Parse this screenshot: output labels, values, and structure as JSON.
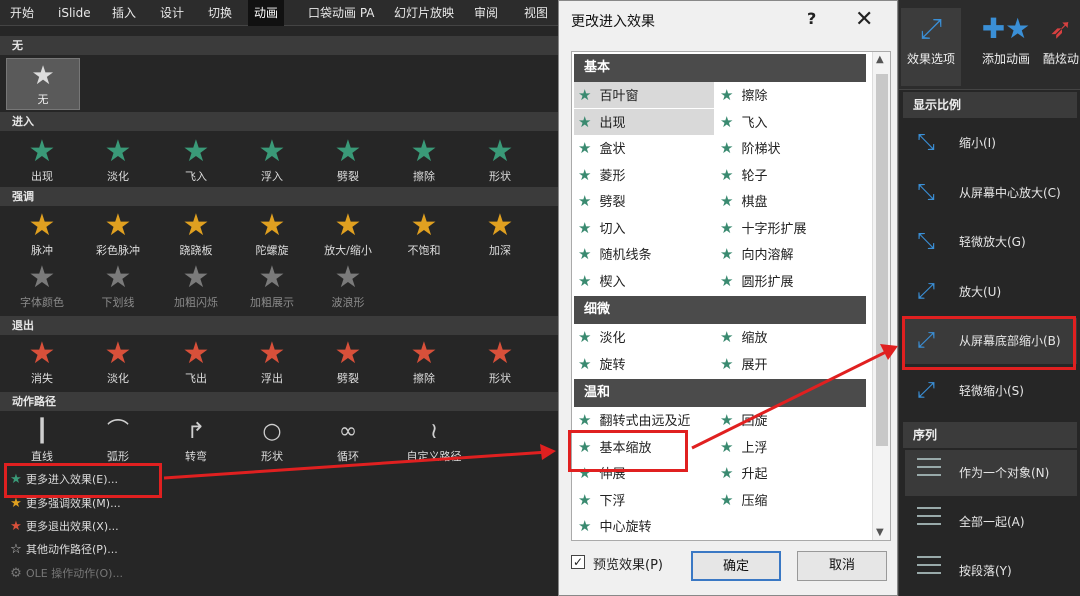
{
  "ribbon": {
    "tabs": [
      "开始",
      "iSlide",
      "插入",
      "设计",
      "切换",
      "动画",
      "口袋动画 PA",
      "幻灯片放映",
      "审阅",
      "视图"
    ],
    "active_tab": "动画"
  },
  "gallery": {
    "none_section": "无",
    "none_label": "无",
    "entrance_section": "进入",
    "entrance": [
      "出现",
      "淡化",
      "飞入",
      "浮入",
      "劈裂",
      "擦除",
      "形状"
    ],
    "emphasis_section": "强调",
    "emphasis_row1": [
      "脉冲",
      "彩色脉冲",
      "跷跷板",
      "陀螺旋",
      "放大/缩小",
      "不饱和",
      "加深"
    ],
    "emphasis_row2": [
      "字体颜色",
      "下划线",
      "加粗闪烁",
      "加粗展示",
      "波浪形"
    ],
    "exit_section": "退出",
    "exit": [
      "消失",
      "淡化",
      "飞出",
      "浮出",
      "劈裂",
      "擦除",
      "形状"
    ],
    "path_section": "动作路径",
    "paths": [
      "直线",
      "弧形",
      "转弯",
      "形状",
      "循环",
      "自定义路径"
    ]
  },
  "more_menu": [
    {
      "label": "更多进入效果(E)...",
      "icon": "star-green"
    },
    {
      "label": "更多强调效果(M)...",
      "icon": "star-yellow"
    },
    {
      "label": "更多退出效果(X)...",
      "icon": "star-red"
    },
    {
      "label": "其他动作路径(P)...",
      "icon": "star-outline"
    },
    {
      "label": "OLE 操作动作(O)...",
      "icon": "gear"
    }
  ],
  "dialog": {
    "title": "更改进入效果",
    "help": "?",
    "close": "✕",
    "groups": [
      {
        "name": "基本",
        "items": [
          "百叶窗",
          "擦除",
          "出现",
          "飞入",
          "盒状",
          "阶梯状",
          "菱形",
          "轮子",
          "劈裂",
          "棋盘",
          "切入",
          "十字形扩展",
          "随机线条",
          "向内溶解",
          "楔入",
          "圆形扩展"
        ]
      },
      {
        "name": "细微",
        "items": [
          "淡化",
          "缩放",
          "旋转",
          "展开"
        ]
      },
      {
        "name": "温和",
        "items": [
          "翻转式由远及近",
          "回旋",
          "基本缩放",
          "上浮",
          "伸展",
          "升起",
          "下浮",
          "压缩",
          "中心旋转"
        ]
      }
    ],
    "preview_label": "预览效果(P)",
    "preview_checked": true,
    "ok": "确定",
    "cancel": "取消"
  },
  "right_panel": {
    "effect_options": "效果选项",
    "add_animation": "添加动画",
    "third_button": "酷炫动",
    "scale_section": "显示比例",
    "scale_options": [
      "缩小(I)",
      "从屏幕中心放大(C)",
      "轻微放大(G)",
      "放大(U)",
      "从屏幕底部缩小(B)",
      "轻微缩小(S)"
    ],
    "selected_option": "从屏幕底部缩小(B)",
    "sequence_section": "序列",
    "sequence_options": [
      "作为一个对象(Ν)",
      "全部一起(A)",
      "按段落(Y)"
    ]
  },
  "colors": {
    "entrance_star": "#3a9a78",
    "emphasis_star": "#e0a020",
    "exit_star": "#d8503a",
    "highlight_red": "#e02020",
    "accent_blue": "#3a8fd6"
  }
}
